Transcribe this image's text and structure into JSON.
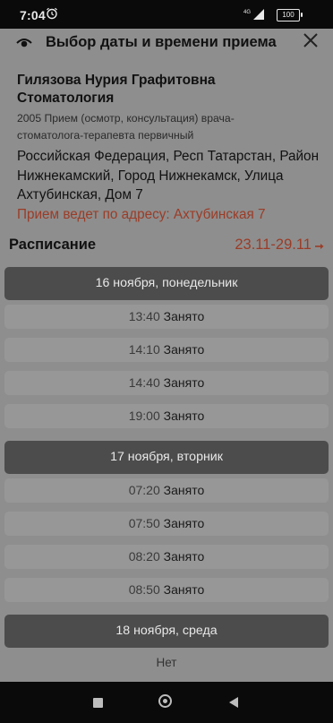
{
  "status_bar": {
    "time": "7:04",
    "battery": "100",
    "network": "4G"
  },
  "header": {
    "title": "Выбор даты и времени приема"
  },
  "doctor": {
    "name": "Гилязова Нурия Графитовна",
    "specialty": "Стоматология",
    "service": "2005 Прием (осмотр, консультация) врача-стоматолога-терапевта первичный",
    "address": "Российская Федерация, Респ Татарстан, Район Нижнекамский, Город Нижнекамск, Улица Ахтубинская, Дом 7",
    "note": "Прием ведет по адресу: Ахтубинская 7"
  },
  "schedule": {
    "title": "Расписание",
    "range": "23.11-29.11",
    "days": [
      {
        "label": "16 ноября, понедельник",
        "slots": [
          {
            "time": "13:40",
            "status": "Занято"
          },
          {
            "time": "14:10",
            "status": "Занято"
          },
          {
            "time": "14:40",
            "status": "Занято"
          },
          {
            "time": "19:00",
            "status": "Занято"
          }
        ]
      },
      {
        "label": "17 ноября, вторник",
        "slots": [
          {
            "time": "07:20",
            "status": "Занято"
          },
          {
            "time": "07:50",
            "status": "Занято"
          },
          {
            "time": "08:20",
            "status": "Занято"
          },
          {
            "time": "08:50",
            "status": "Занято"
          }
        ]
      },
      {
        "label": "18 ноября, среда",
        "none_text": "Нет"
      }
    ]
  },
  "colors": {
    "accent": "#9b3c27",
    "day_header_bg": "#4c4c4c",
    "slot_bg": "#979797",
    "page_bg": "#8e8e8e"
  }
}
